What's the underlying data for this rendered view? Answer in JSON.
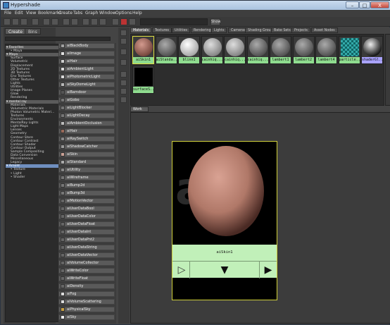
{
  "window": {
    "title": "Hypershade",
    "minimize": "–",
    "maximize": "□",
    "close": "X"
  },
  "menus": [
    "File",
    "Edit",
    "View",
    "Bookmarks",
    "Create",
    "Tabs",
    "Graph",
    "Window",
    "Options",
    "Help"
  ],
  "toolbar": {
    "show_label": "Show"
  },
  "left_tabs": [
    "Create",
    "Bins"
  ],
  "tree": [
    {
      "text": "▾ Favorites",
      "kind": "hdr"
    },
    {
      "text": "‣ Maya",
      "kind": "item"
    },
    {
      "text": "▾ Maya",
      "kind": "hdr"
    },
    {
      "text": "Surface",
      "kind": "item"
    },
    {
      "text": "Volumetric",
      "kind": "item"
    },
    {
      "text": "Displacement",
      "kind": "item"
    },
    {
      "text": "2D Textures",
      "kind": "item"
    },
    {
      "text": "3D Textures",
      "kind": "item"
    },
    {
      "text": "Env Textures",
      "kind": "item"
    },
    {
      "text": "Other Textures",
      "kind": "item"
    },
    {
      "text": "Lights",
      "kind": "item"
    },
    {
      "text": "Utilities",
      "kind": "item"
    },
    {
      "text": "Image Planes",
      "kind": "item"
    },
    {
      "text": "Glow",
      "kind": "item"
    },
    {
      "text": "Rendering",
      "kind": "item"
    },
    {
      "text": "▾ mental ray",
      "kind": "hdr"
    },
    {
      "text": "Materials",
      "kind": "item"
    },
    {
      "text": "Volumetric Materials",
      "kind": "item"
    },
    {
      "text": "Photon Volumetric Materi...",
      "kind": "item"
    },
    {
      "text": "Textures",
      "kind": "item"
    },
    {
      "text": "Environments",
      "kind": "item"
    },
    {
      "text": "MentalRay Lights",
      "kind": "item"
    },
    {
      "text": "Light Maps",
      "kind": "item"
    },
    {
      "text": "Lenses",
      "kind": "item"
    },
    {
      "text": "Geometry",
      "kind": "item"
    },
    {
      "text": "Contour Store",
      "kind": "item"
    },
    {
      "text": "Contour Contrast",
      "kind": "item"
    },
    {
      "text": "Contour Shader",
      "kind": "item"
    },
    {
      "text": "Contour Output",
      "kind": "item"
    },
    {
      "text": "Sample Compositing",
      "kind": "item"
    },
    {
      "text": "Data Conversion",
      "kind": "item"
    },
    {
      "text": "Miscellaneous",
      "kind": "item"
    },
    {
      "text": "Legacy",
      "kind": "item"
    },
    {
      "text": "▾ Arnold",
      "kind": "sel"
    },
    {
      "text": "‣ Texture",
      "kind": "item"
    },
    {
      "text": "‣ Light",
      "kind": "item"
    },
    {
      "text": "‣ Shader",
      "kind": "item"
    }
  ],
  "nodes": [
    {
      "label": "aiBlackBody",
      "icon": "#a0a0a0"
    },
    {
      "label": "aiImage",
      "icon": "#e0e0e0"
    },
    {
      "label": "aiHair",
      "icon": "#cfcfcf"
    },
    {
      "label": "aiAmbientLight",
      "icon": "#d9d9d9"
    },
    {
      "label": "aiPhotometricLight",
      "icon": "#d9d9d9"
    },
    {
      "label": "aiSkyDomeLight",
      "icon": "#b8b8b8"
    },
    {
      "label": "aiBarndoor",
      "icon": "#555"
    },
    {
      "label": "aiGobo",
      "icon": "#777"
    },
    {
      "label": "aiLightBlocker",
      "icon": "#777"
    },
    {
      "label": "aiLightDecay",
      "icon": "#777"
    },
    {
      "label": "aiAmbientOcclusion",
      "icon": "#bbb"
    },
    {
      "label": "aiHair",
      "icon": "#9a6a5a"
    },
    {
      "label": "aiRaySwitch",
      "icon": "#888"
    },
    {
      "label": "aiShadowCatcher",
      "icon": "#999"
    },
    {
      "label": "aiSkin",
      "icon": "#c9a095"
    },
    {
      "label": "aiStandard",
      "icon": "#aaa"
    },
    {
      "label": "aiUtility",
      "icon": "#888"
    },
    {
      "label": "aiWireframe",
      "icon": "#777"
    },
    {
      "label": "aiBump2d",
      "icon": "#777"
    },
    {
      "label": "aiBump3d",
      "icon": "#777"
    },
    {
      "label": "aiMotionVector",
      "icon": "#666"
    },
    {
      "label": "aiUserDataBool",
      "icon": "#666"
    },
    {
      "label": "aiUserDataColor",
      "icon": "#666"
    },
    {
      "label": "aiUserDataFloat",
      "icon": "#666"
    },
    {
      "label": "aiUserDataInt",
      "icon": "#666"
    },
    {
      "label": "aiUserDataPnt2",
      "icon": "#666"
    },
    {
      "label": "aiUserDataString",
      "icon": "#666"
    },
    {
      "label": "aiUserDataVector",
      "icon": "#666"
    },
    {
      "label": "aiVolumeCollector",
      "icon": "#666"
    },
    {
      "label": "aiWriteColor",
      "icon": "#666"
    },
    {
      "label": "aiWriteFloat",
      "icon": "#666"
    },
    {
      "label": "aiDensity",
      "icon": "#666"
    },
    {
      "label": "aiFog",
      "icon": "#ddd"
    },
    {
      "label": "aiVolumeScattering",
      "icon": "#ddd"
    },
    {
      "label": "aiPhysicalSky",
      "icon": "#c8a040"
    },
    {
      "label": "aiSky",
      "icon": "#eee"
    }
  ],
  "hypershade_tabs": [
    "Materials",
    "Textures",
    "Utilities",
    "Rendering",
    "Lights",
    "Cameras",
    "Shading Groups",
    "Bake Sets",
    "Projects",
    "Asset Nodes"
  ],
  "swatches": [
    {
      "label": "aiSkin1",
      "style": "skin",
      "state": "selected"
    },
    {
      "label": "aiStanda...",
      "style": "grey",
      "state": ""
    },
    {
      "label": "blinn1",
      "style": "white",
      "state": ""
    },
    {
      "label": "cainhiq...",
      "style": "light",
      "state": ""
    },
    {
      "label": "cainhiq...",
      "style": "light",
      "state": ""
    },
    {
      "label": "cainhiq...",
      "style": "grey",
      "state": ""
    },
    {
      "label": "lambert1",
      "style": "grey",
      "state": ""
    },
    {
      "label": "lambert2",
      "style": "grey",
      "state": ""
    },
    {
      "label": "lambert4",
      "style": "grey",
      "state": ""
    },
    {
      "label": "particle...",
      "style": "checker",
      "state": ""
    },
    {
      "label": "shaderGl...",
      "style": "dark",
      "state": "selected2"
    },
    {
      "label": "surfaceS...",
      "style": "black",
      "state": ""
    }
  ],
  "work_area": {
    "tab": "Work Area",
    "watermark": "ai",
    "node_label": "aiSkin1",
    "btn_left": "▷",
    "btn_mid": "▼",
    "btn_right": "▶"
  }
}
